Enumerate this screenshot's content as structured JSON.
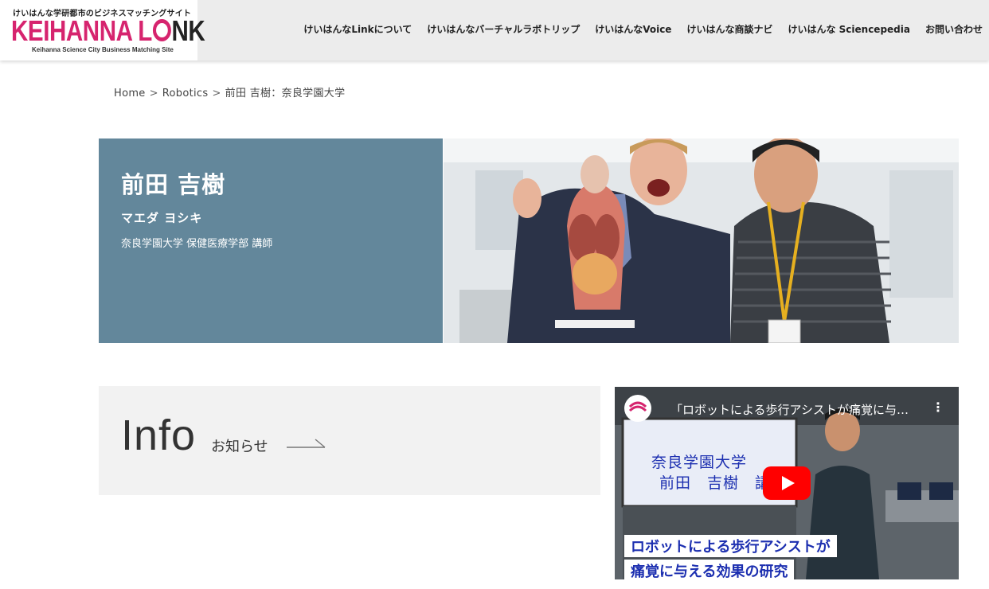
{
  "header": {
    "logo_tagline": "けいはんな学研都市のビジネスマッチングサイト",
    "logo_word_left": "KEIHANNA L",
    "logo_word_right": "NK",
    "logo_subtitle": "Keihanna Science City Business Matching Site",
    "nav": [
      {
        "label": "けいはんなLinkについて"
      },
      {
        "label": "けいはんなバーチャルラボトリップ"
      },
      {
        "label": "けいはんなVoice"
      },
      {
        "label": "けいはんな商談ナビ"
      },
      {
        "label": "けいはんな Sciencepedia"
      },
      {
        "label": "お問い合わせ"
      }
    ]
  },
  "breadcrumb": {
    "home": "Home",
    "category": "Robotics",
    "current": "前田 吉樹：奈良学園大学",
    "separator": ">"
  },
  "profile": {
    "name": "前田 吉樹",
    "kana": "マエダ ヨシキ",
    "affiliation": "奈良学園大学 保健医療学部 講師",
    "card_color": "#63879b"
  },
  "info": {
    "title": "Info",
    "subtitle": "お知らせ"
  },
  "video": {
    "title": "「ロボットによる歩行アシストが痛覚に与…",
    "menu_icon": "⋮",
    "slide_university": "奈良学園大学",
    "slide_name": "前田　吉樹　講師",
    "caption_line1": "ロボットによる歩行アシストが",
    "caption_line2": "痛覚に与える効果の研究"
  },
  "colors": {
    "brand_pink": "#d6246e",
    "caption_blue": "#1c2fb0",
    "youtube_red": "#ff0000"
  }
}
